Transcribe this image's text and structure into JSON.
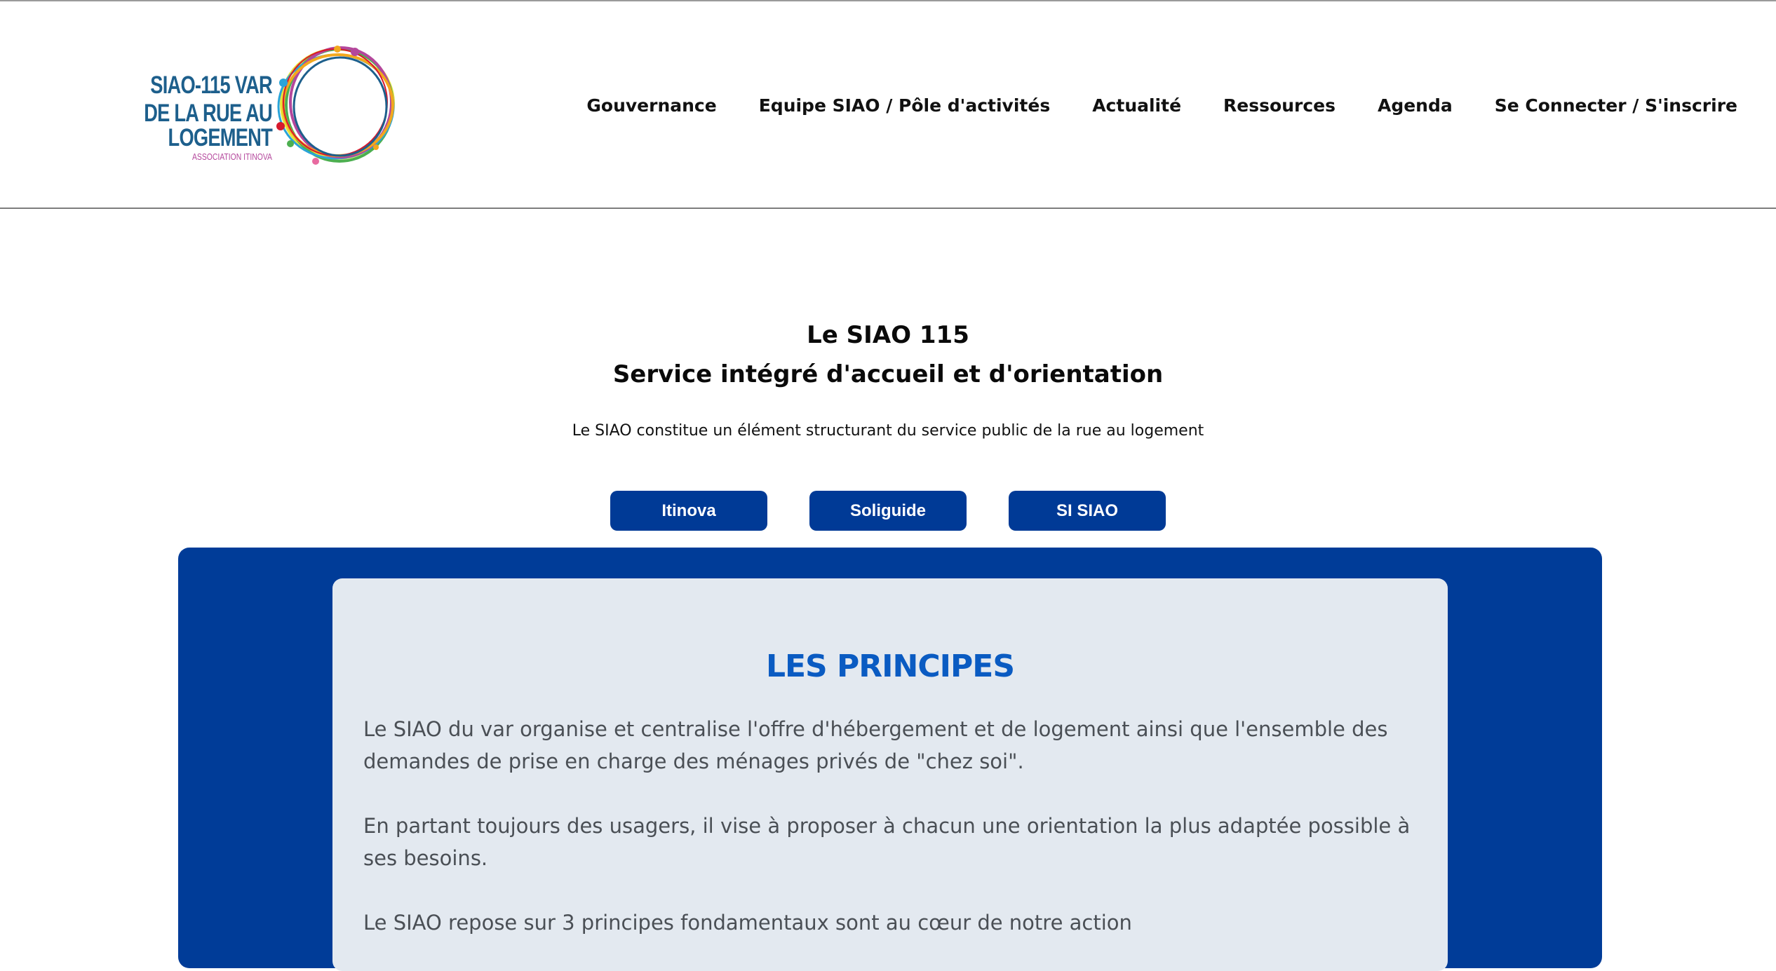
{
  "logo": {
    "line1": "SIAO-115 VAR",
    "line2": "DE LA RUE AU LOGEMENT",
    "line3": "ASSOCIATION ITINOVA",
    "colors": [
      "#1d5f8c",
      "#f2a81d",
      "#d7192d",
      "#4caf50",
      "#b4479c",
      "#2aa4d8",
      "#e8e43a"
    ]
  },
  "nav": {
    "items": [
      "Gouvernance",
      "Equipe SIAO / Pôle d'activités",
      "Actualité",
      "Ressources",
      "Agenda",
      "Se Connecter / S'inscrire"
    ]
  },
  "hero": {
    "title_line1": "Le SIAO 115",
    "title_line2": "Service intégré d'accueil et d'orientation",
    "subtitle": "Le SIAO constitue un élément structurant du service public de la rue au logement"
  },
  "buttons": [
    "Itinova",
    "Soliguide",
    "SI SIAO"
  ],
  "principles": {
    "title": "LES PRINCIPES",
    "paragraphs": [
      "Le SIAO du var organise et centralise l'offre d'hébergement et de logement ainsi que l'ensemble des demandes de prise en charge des ménages privés de \"chez soi\".",
      "En partant toujours des usagers, il vise à proposer à chacun une orientation la plus adaptée possible à ses besoins.",
      "Le SIAO repose sur 3 principes fondamentaux sont au cœur de notre action"
    ]
  },
  "colors": {
    "primary_blue": "#003a96",
    "panel_blue": "#003c98",
    "card_bg": "#e3e9f0",
    "title_blue": "#0a5bc2"
  }
}
